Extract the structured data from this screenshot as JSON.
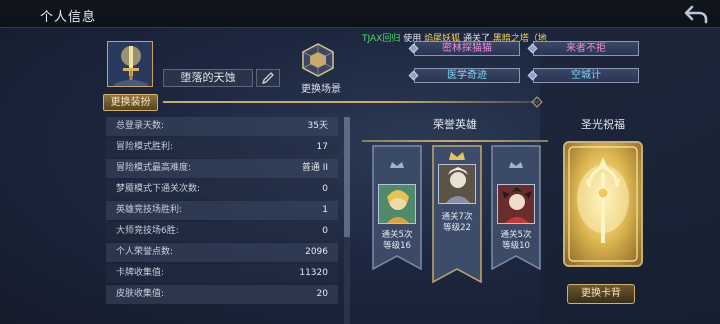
{
  "header": {
    "title": "个人信息",
    "back_icon": "back-arrow-icon"
  },
  "marquee": {
    "player": "TJAX回归",
    "verb1": " 使用 ",
    "hero": "焰尾妖狐",
    "verb2": " 通关了 ",
    "dungeon": "黑暗之塔（地"
  },
  "profile": {
    "title_name": "堕落的天蚀",
    "change_scene_label": "更换场景",
    "dress_button": "更换装扮",
    "titles": [
      "密林探猫猫",
      "来者不拒",
      "医学奇迹",
      "空城计"
    ]
  },
  "stats": [
    {
      "label": "总登录天数:",
      "value": "35天"
    },
    {
      "label": "冒险模式胜利:",
      "value": "17"
    },
    {
      "label": "冒险模式最高难度:",
      "value": "普通 II"
    },
    {
      "label": "梦魇模式下通关次数:",
      "value": "0"
    },
    {
      "label": "英雄竞技场胜利:",
      "value": "1"
    },
    {
      "label": "大师竞技场6胜:",
      "value": "0"
    },
    {
      "label": "个人荣誉点数:",
      "value": "2096"
    },
    {
      "label": "卡牌收集值:",
      "value": "11320"
    },
    {
      "label": "皮肤收集值:",
      "value": "20"
    }
  ],
  "honor": {
    "title": "荣誉英雄",
    "heroes": [
      {
        "line1": "通关5次",
        "line2": "等级16"
      },
      {
        "line1": "通关7次",
        "line2": "等级22"
      },
      {
        "line1": "通关5次",
        "line2": "等级10"
      }
    ]
  },
  "card_back": {
    "title": "圣光祝福",
    "button": "更换卡背"
  },
  "colors": {
    "gold": "#c9ac6c",
    "name_green": "#4ddc6a",
    "highlight_yellow": "#f2d35a",
    "title_pink": "#f08ad8",
    "title_blue": "#7fd6f5"
  }
}
